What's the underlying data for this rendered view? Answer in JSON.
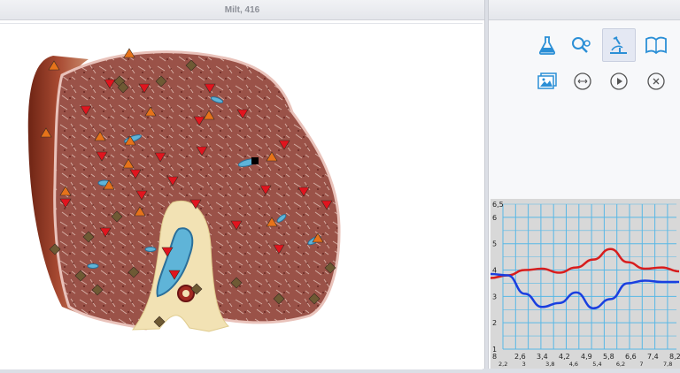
{
  "window": {
    "title": "Milt, 416"
  },
  "toolbar": {
    "tools": [
      {
        "name": "flask-tool",
        "icon": "flask-icon",
        "active": false
      },
      {
        "name": "magnify-tool",
        "icon": "magnify-icon",
        "active": false
      },
      {
        "name": "microscope-tool",
        "icon": "microscope-icon",
        "active": true
      },
      {
        "name": "book-tool",
        "icon": "book-icon",
        "active": false
      },
      {
        "name": "gallery-tool",
        "icon": "gallery-icon",
        "active": false
      },
      {
        "name": "expand-tool",
        "icon": "arrows-horizontal-icon",
        "active": false
      },
      {
        "name": "play-tool",
        "icon": "play-icon",
        "active": false
      },
      {
        "name": "close-tool",
        "icon": "close-icon",
        "active": false
      }
    ],
    "accent": "#2b8fd6"
  },
  "colors": {
    "marker_red": "#e0141e",
    "marker_orange": "#e6731a",
    "marker_olive": "#6e5a34",
    "line_red": "#d81d1d",
    "line_blue": "#1a3fe0",
    "grid": "#59b8e6"
  },
  "chart_data": {
    "type": "line",
    "y_ticks": [
      "6,5",
      "6",
      "5",
      "4",
      "3",
      "2",
      "1"
    ],
    "x_ticks_top": [
      "8",
      "2,6",
      "3,4",
      "4,2",
      "4,9",
      "5,8",
      "6,6",
      "7,4",
      "8,2"
    ],
    "x_ticks_bottom": [
      "2,2",
      "3",
      "3,8",
      "4,6",
      "5,4",
      "6,2",
      "7",
      "7,8"
    ],
    "ylim": [
      1,
      6.5
    ],
    "series": [
      {
        "color": "#d81d1d",
        "y": [
          3.7,
          3.8,
          4.0,
          4.05,
          3.9,
          4.1,
          4.4,
          4.8,
          4.3,
          4.05,
          4.1,
          3.95
        ]
      },
      {
        "color": "#1a3fe0",
        "y": [
          3.85,
          3.8,
          3.1,
          2.6,
          2.75,
          3.15,
          2.55,
          2.9,
          3.5,
          3.6,
          3.55,
          3.55
        ]
      }
    ]
  }
}
